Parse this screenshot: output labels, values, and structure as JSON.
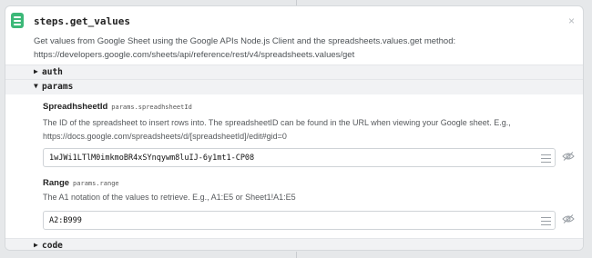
{
  "step": {
    "name": "steps.get_values",
    "description_line1": "Get values from Google Sheet using the Google APIs Node.js Client and the spreadsheets.values.get method:",
    "description_line2": "https://developers.google.com/sheets/api/reference/rest/v4/spreadsheets.values/get",
    "close_glyph": "×"
  },
  "sections": {
    "auth": {
      "caret": "▶",
      "label": "auth"
    },
    "params": {
      "caret": "▼",
      "label": "params"
    },
    "code": {
      "caret": "▶",
      "label": "code"
    }
  },
  "params": {
    "spreadsheet_id": {
      "label": "SpreadhsheetId",
      "path": "params.spreadhsheetId",
      "description_line1": "The ID of the spreadsheet to insert rows into. The spreadsheetID can be found in the URL when viewing your Google sheet. E.g.,",
      "description_line2": "https://docs.google.com/spreadsheets/d/[spreadsheetId]/edit#gid=0",
      "value": "1wJWi1LTlM0imkmoBR4xSYnqywm8luIJ-6y1mt1-CP08"
    },
    "range": {
      "label": "Range",
      "path": "params.range",
      "description": "The A1 notation of the values to retrieve. E.g., A1:E5 or Sheet1!A1:E5",
      "value": "A2:B999"
    }
  },
  "colors": {
    "step_icon": "#3cb878",
    "section_bg": "#f1f2f4",
    "background": "#e6e8ea"
  }
}
